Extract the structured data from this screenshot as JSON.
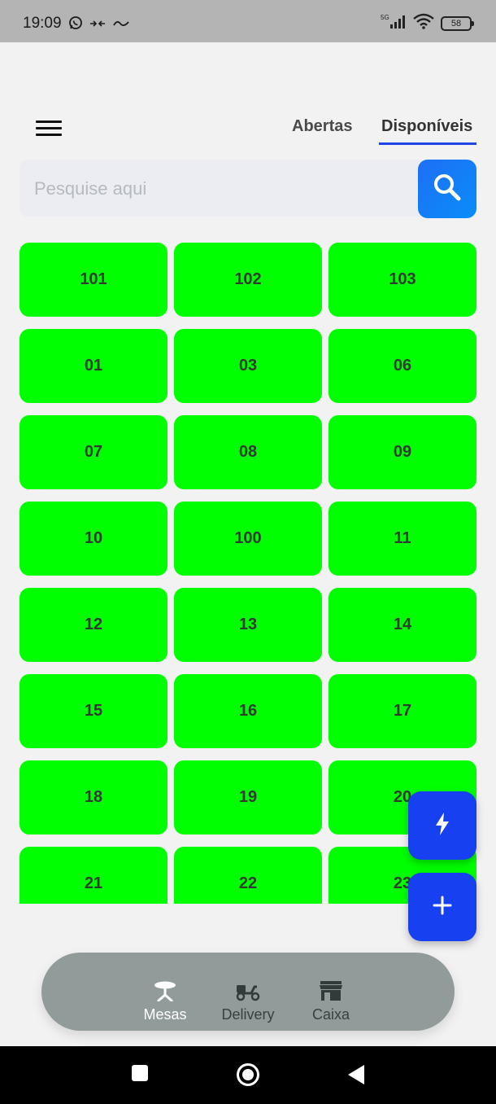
{
  "status_bar": {
    "time": "19:09",
    "network": "5G",
    "battery": "58"
  },
  "header": {
    "tabs": [
      {
        "label": "Abertas",
        "active": false
      },
      {
        "label": "Disponíveis",
        "active": true
      }
    ],
    "accent_color": "#1f45e6"
  },
  "search": {
    "placeholder": "Pesquise aqui",
    "value": ""
  },
  "tables": {
    "color": "#00ff00",
    "items": [
      "101",
      "102",
      "103",
      "01",
      "03",
      "06",
      "07",
      "08",
      "09",
      "10",
      "100",
      "11",
      "12",
      "13",
      "14",
      "15",
      "16",
      "17",
      "18",
      "19",
      "20",
      "21",
      "22",
      "23"
    ]
  },
  "fabs": {
    "quick": {
      "icon": "flash-icon"
    },
    "add": {
      "icon": "plus-icon"
    }
  },
  "bottom_nav": {
    "items": [
      {
        "label": "Mesas",
        "icon": "table-icon",
        "active": true
      },
      {
        "label": "Delivery",
        "icon": "scooter-icon",
        "active": false
      },
      {
        "label": "Caixa",
        "icon": "store-icon",
        "active": false
      }
    ]
  }
}
